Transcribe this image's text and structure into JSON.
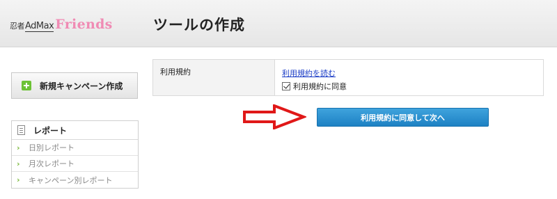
{
  "header": {
    "logo": {
      "ninja": "忍者",
      "admax": "AdMax",
      "friends": "Friends"
    },
    "title": "ツールの作成"
  },
  "sidebar": {
    "create_button_label": "新規キャンペーン作成",
    "report": {
      "title": "レポート",
      "items": [
        {
          "label": "日別レポート"
        },
        {
          "label": "月次レポート"
        },
        {
          "label": "キャンペーン別レポート"
        }
      ]
    }
  },
  "main": {
    "terms": {
      "label": "利用規約",
      "link_text": "利用規約を読む",
      "checkbox_label": "利用規約に同意",
      "checked": true
    },
    "submit_label": "利用規約に同意して次へ"
  },
  "colors": {
    "accent_blue": "#2a8fd0",
    "friends_pink": "#f08bb4",
    "plus_green": "#6cc235",
    "arrow_red": "#e01818"
  }
}
